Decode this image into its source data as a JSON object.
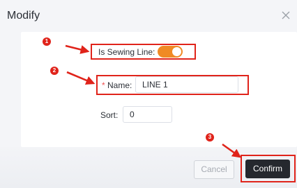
{
  "dialog": {
    "title": "Modify",
    "close_icon": "close-icon"
  },
  "form": {
    "sewing_line": {
      "label": "Is Sewing Line:",
      "enabled": true
    },
    "name": {
      "required_mark": "*",
      "label": "Name:",
      "value": "LINE 1"
    },
    "sort": {
      "label": "Sort:",
      "value": "0"
    }
  },
  "footer": {
    "cancel_label": "Cancel",
    "confirm_label": "Confirm"
  },
  "annotations": {
    "badges": [
      "1",
      "2",
      "3"
    ],
    "highlight_color": "#e0231a"
  },
  "colors": {
    "toggle_on": "#f08a24",
    "confirm_bg": "#25282e"
  }
}
